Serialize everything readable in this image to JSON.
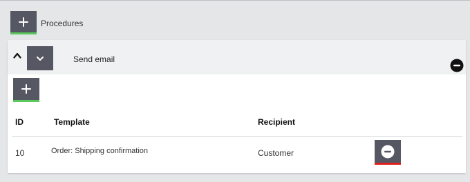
{
  "procedures": {
    "label": "Procedures",
    "add_button": {
      "icon": "plus-icon",
      "accent": "#5ac85a"
    }
  },
  "procedure": {
    "name": "Send email",
    "collapse_icon": "chevron-up-icon",
    "expand_icon": "chevron-down-icon",
    "remove_icon": "minus-circle-icon"
  },
  "emails": {
    "add_button": {
      "icon": "plus-icon",
      "accent": "#5ac85a"
    },
    "columns": {
      "id": "ID",
      "template": "Template",
      "recipient": "Recipient"
    },
    "rows": [
      {
        "id": "10",
        "template": "Order: Shipping confirmation",
        "recipient": "Customer",
        "remove_accent": "#e02020"
      }
    ]
  }
}
